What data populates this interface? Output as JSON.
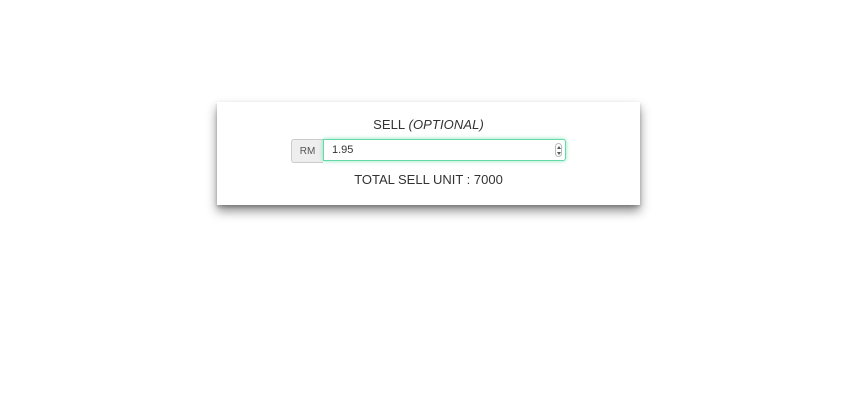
{
  "sell_panel": {
    "title_main": "SELL",
    "title_optional": "(OPTIONAL)",
    "currency_addon": "RM",
    "price_value": "1.95",
    "total_label": "TOTAL SELL UNIT : 7000"
  },
  "colors": {
    "focus_border": "#66d9a8",
    "addon_background": "#eeeeee"
  },
  "icons": {
    "stepper": "number-stepper-icon"
  }
}
